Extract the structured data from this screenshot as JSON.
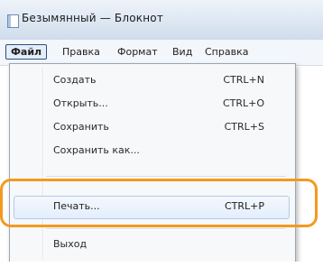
{
  "window": {
    "title": "Безымянный — Блокнот"
  },
  "menubar": {
    "items": [
      {
        "label": "Файл",
        "active": true
      },
      {
        "label": "Правка"
      },
      {
        "label": "Формат"
      },
      {
        "label": "Вид"
      },
      {
        "label": "Справка"
      }
    ]
  },
  "file_menu": {
    "items": [
      {
        "label": "Создать",
        "shortcut": "CTRL+N"
      },
      {
        "label": "Открыть...",
        "shortcut": "CTRL+O"
      },
      {
        "label": "Сохранить",
        "shortcut": "CTRL+S"
      },
      {
        "label": "Сохранить как...",
        "shortcut": ""
      },
      {
        "label": "Печать...",
        "shortcut": "CTRL+P",
        "highlighted": true
      },
      {
        "label": "Выход",
        "shortcut": ""
      }
    ]
  },
  "colors": {
    "callout": "#f39a1e",
    "highlight_border": "#aecbeb"
  }
}
